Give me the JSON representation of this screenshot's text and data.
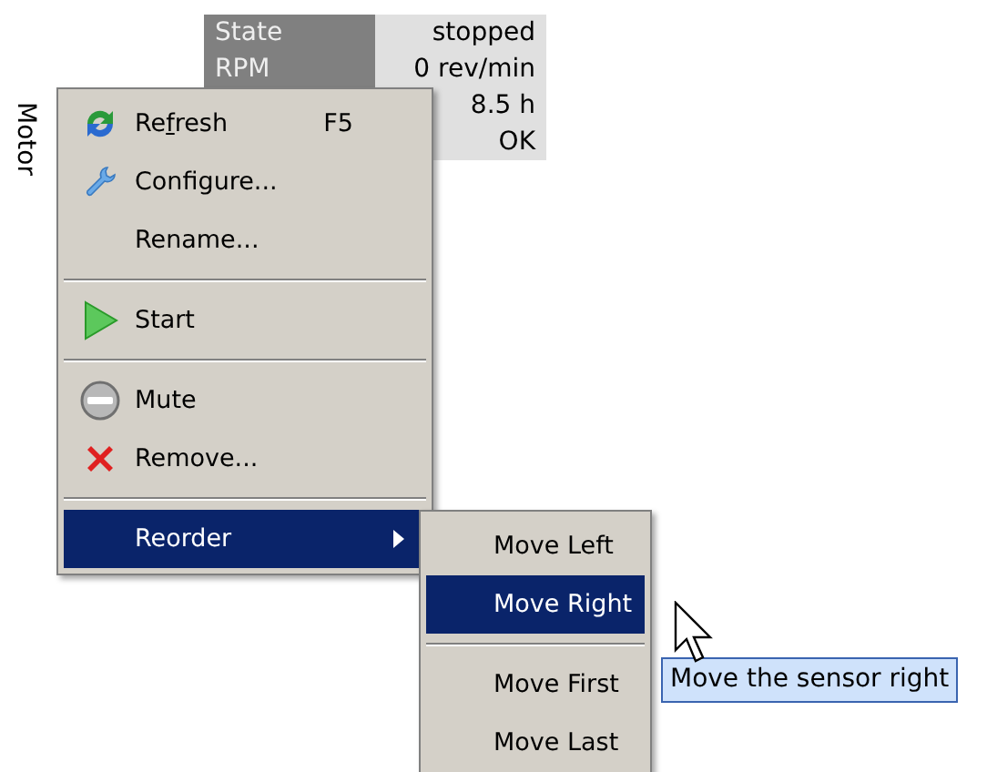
{
  "panel_title": "Motor",
  "properties": [
    {
      "label": "State",
      "value": "stopped"
    },
    {
      "label": "RPM",
      "value": "0 rev/min"
    },
    {
      "value": "8.5 h"
    },
    {
      "value": "OK"
    }
  ],
  "context_menu": {
    "items": [
      {
        "kind": "item",
        "label_segments": [
          {
            "text": "Re",
            "underlined": false
          },
          {
            "text": "f",
            "underlined": true
          },
          {
            "text": "resh",
            "underlined": false
          }
        ],
        "shortcut": "F5",
        "selected": false
      },
      {
        "kind": "item",
        "label": "Configure...",
        "selected": false
      },
      {
        "kind": "item",
        "label": "Rename...",
        "selected": false
      },
      {
        "kind": "separator"
      },
      {
        "kind": "item",
        "label": "Start",
        "selected": false
      },
      {
        "kind": "separator"
      },
      {
        "kind": "item",
        "label": "Mute",
        "selected": false
      },
      {
        "kind": "item",
        "label": "Remove...",
        "selected": false
      },
      {
        "kind": "separator"
      },
      {
        "kind": "submenu",
        "label": "Reorder",
        "selected": true
      }
    ]
  },
  "submenu": {
    "items": [
      {
        "kind": "item",
        "label": "Move Left",
        "selected": false
      },
      {
        "kind": "item",
        "label": "Move Right",
        "selected": true
      },
      {
        "kind": "separator"
      },
      {
        "kind": "item",
        "label": "Move First",
        "selected": false
      },
      {
        "kind": "item",
        "label": "Move Last",
        "selected": false
      }
    ]
  },
  "tooltip": {
    "text": "Move the sensor right"
  }
}
